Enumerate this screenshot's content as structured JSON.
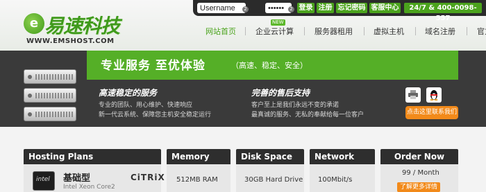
{
  "header": {
    "logo": {
      "brand": "易速科技",
      "url": "WWW.EMSHOST.COM"
    },
    "login": {
      "username_value": "Username",
      "password_value": "••••••",
      "login_label": "登录",
      "register_label": "注册",
      "forgot_label": "忘记密码",
      "client_center_label": "客服中心",
      "hotline": "24/7 & 400-0098-557"
    },
    "nav": {
      "items": [
        {
          "label": "网站首页",
          "active": true
        },
        {
          "label": "企业云计算",
          "badge": "NEW"
        },
        {
          "label": "服务器租用"
        },
        {
          "label": "虚拟主机"
        },
        {
          "label": "域名注册"
        },
        {
          "label": "官方博客"
        }
      ]
    }
  },
  "banner": {
    "slogan": "专业服务 至优体验",
    "slogan_sub": "（高速、稳定、安全）",
    "features": [
      {
        "title": "高速稳定的服务",
        "lines": [
          "专业的团队、用心维护、快速响应",
          "新一代云系统、保障您主机安全稳定运行"
        ]
      },
      {
        "title": "完善的售后支持",
        "lines": [
          "客户至上是我们永远不变的承诺",
          "最真诚的服务、无私的奉献给每一位客户"
        ]
      }
    ],
    "contact_label": "点击这里联系我们"
  },
  "plans": {
    "headers": [
      "Hosting Plans",
      "Memory",
      "Disk Space",
      "Network",
      "Order Now"
    ],
    "row": {
      "cpu_chip": "intel",
      "name": "基础型",
      "cpu": "Intel Xeon Core2",
      "vendor": "CiTRiX",
      "memory": "512MB RAM",
      "disk": "30GB Hard Drive",
      "network": "100Mbit/s",
      "price": "99 / Month",
      "more_label": "了解更多详情"
    }
  },
  "colors": {
    "brand_green": "#4ba31d",
    "accent_orange": "#f28a1a",
    "dark": "#3a3a3a"
  }
}
